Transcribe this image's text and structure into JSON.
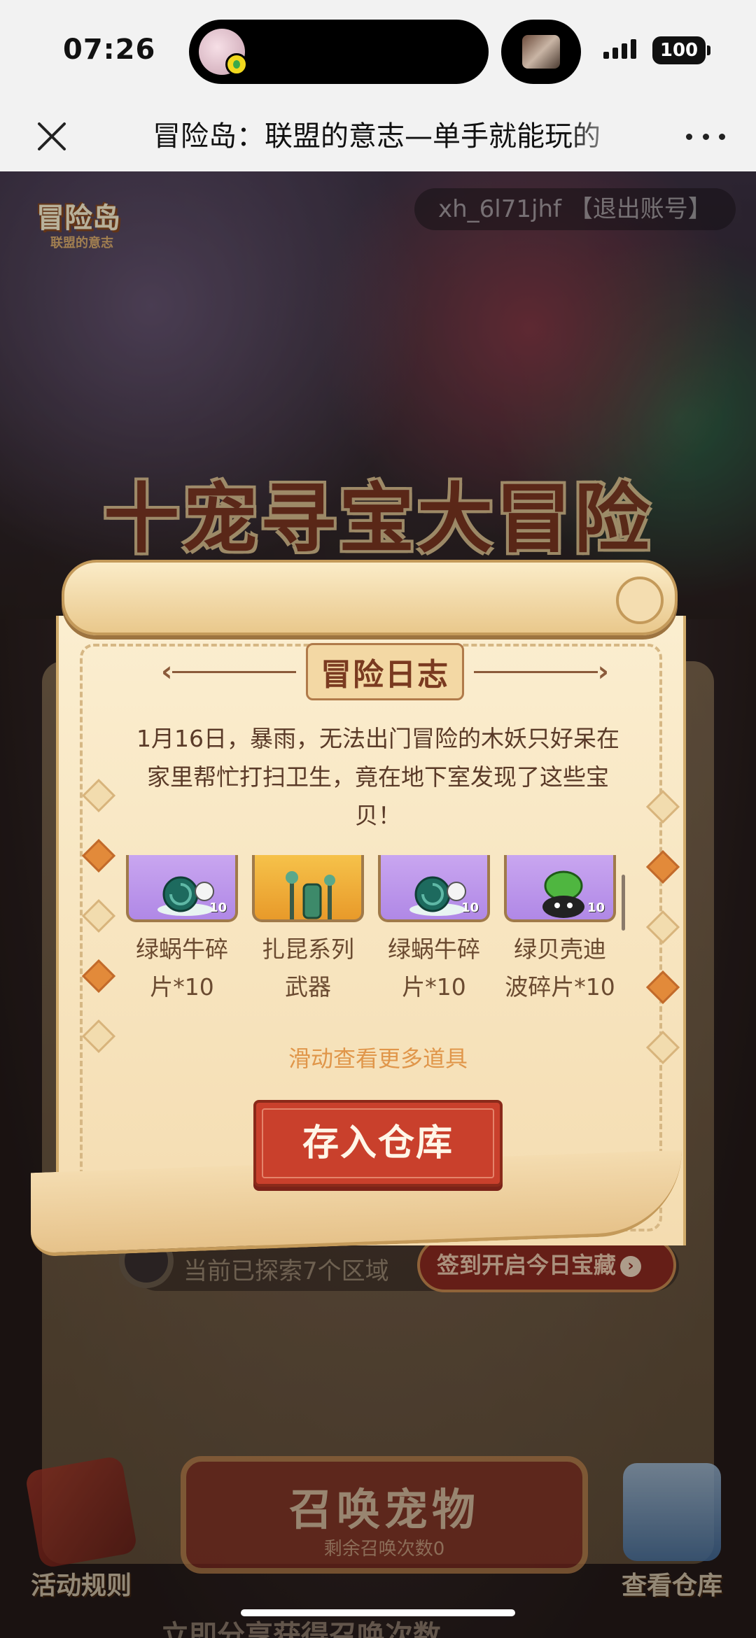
{
  "status_bar": {
    "time": "07:26",
    "battery": "100"
  },
  "nav": {
    "title": "冒险岛：联盟的意志—单手就能玩的",
    "close_icon": "close-icon",
    "more_icon": "more-icon"
  },
  "game": {
    "account_label": "xh_6l71jhf 【退出账号】",
    "logo": {
      "name": "冒险岛",
      "subtitle": "联盟的意志"
    },
    "event_title": "十宠寻宝大冒险",
    "explore_text": "当前已探索7个区域",
    "checkin_label": "签到开启今日宝藏",
    "summon": {
      "title": "召唤宠物",
      "remaining": "剩余召唤次数0"
    },
    "rules_label": "活动规则",
    "warehouse_label": "查看仓库",
    "bottom_strip": "立即分享获得召唤次数"
  },
  "modal": {
    "header": "冒险日志",
    "story": "1月16日，暴雨，无法出门冒险的木妖只好呆在家里帮忙打扫卫生，竟在地下室发现了这些宝贝！",
    "items": [
      {
        "name": "绿蜗牛碎片*10",
        "count": "10",
        "rarity": "SR",
        "bg": "purple",
        "icon": "green-snail-icon"
      },
      {
        "name": "扎昆系列武器",
        "count": "",
        "rarity": "",
        "bg": "gold",
        "icon": "zakum-weapons-icon"
      },
      {
        "name": "绿蜗牛碎片*10",
        "count": "10",
        "rarity": "SR",
        "bg": "purple",
        "icon": "green-snail-icon"
      },
      {
        "name": "绿贝壳迪波碎片*10",
        "count": "10",
        "rarity": "SR",
        "bg": "purple",
        "icon": "green-shell-mushroom-icon"
      }
    ],
    "swipe_hint": "滑动查看更多道具",
    "store_button": "存入仓库"
  },
  "colors": {
    "accent_red": "#c9402c",
    "parchment": "#fbeed0",
    "hint_orange": "#e0964a"
  }
}
